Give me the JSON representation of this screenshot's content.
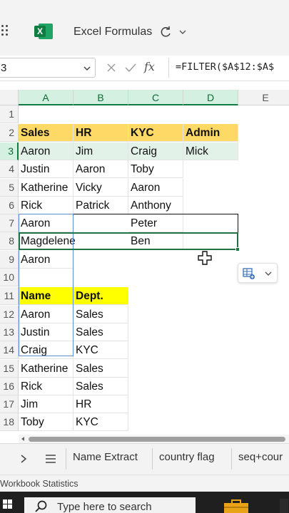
{
  "title_bar": {
    "document_title": "Excel Formulas",
    "app_icon_letter": "X"
  },
  "formula_bar": {
    "name_box": "3",
    "formula": "=FILTER($A$12:$A$"
  },
  "columns": [
    "A",
    "B",
    "C",
    "D",
    "E"
  ],
  "rows": [
    "1",
    "2",
    "3",
    "4",
    "5",
    "6",
    "7",
    "8",
    "9",
    "10",
    "11",
    "12",
    "13",
    "14",
    "15",
    "16",
    "17",
    "18"
  ],
  "summary_table": {
    "headers": [
      "Sales",
      "HR",
      "KYC",
      "Admin"
    ],
    "sales": [
      "Aaron",
      "Justin",
      "Katherine",
      "Rick",
      "Aaron",
      "Magdelene",
      "Aaron"
    ],
    "hr": [
      "Jim",
      "Aaron",
      "Vicky",
      "Patrick"
    ],
    "kyc": [
      "Craig",
      "Toby",
      "Aaron",
      "Anthony",
      "Peter",
      "Ben"
    ],
    "admin": [
      "Mick"
    ]
  },
  "source_table": {
    "headers": [
      "Name",
      "Dept."
    ],
    "rows": [
      [
        "Aaron",
        "Sales"
      ],
      [
        "Justin",
        "Sales"
      ],
      [
        "Craig",
        "KYC"
      ],
      [
        "Katherine",
        "Sales"
      ],
      [
        "Rick",
        "Sales"
      ],
      [
        "Jim",
        "HR"
      ],
      [
        "Toby",
        "KYC"
      ]
    ]
  },
  "sheet_tabs": [
    "Name Extract",
    "country flag",
    "seq+cour"
  ],
  "status_bar": {
    "text": "Workbook Statistics"
  },
  "taskbar": {
    "search_placeholder": "Type here to search"
  },
  "colors": {
    "header_orange": "#ffd966",
    "header_yellow": "#ffff00",
    "selection_green": "#217346",
    "selected_row_fill": "#e3f2e8"
  }
}
